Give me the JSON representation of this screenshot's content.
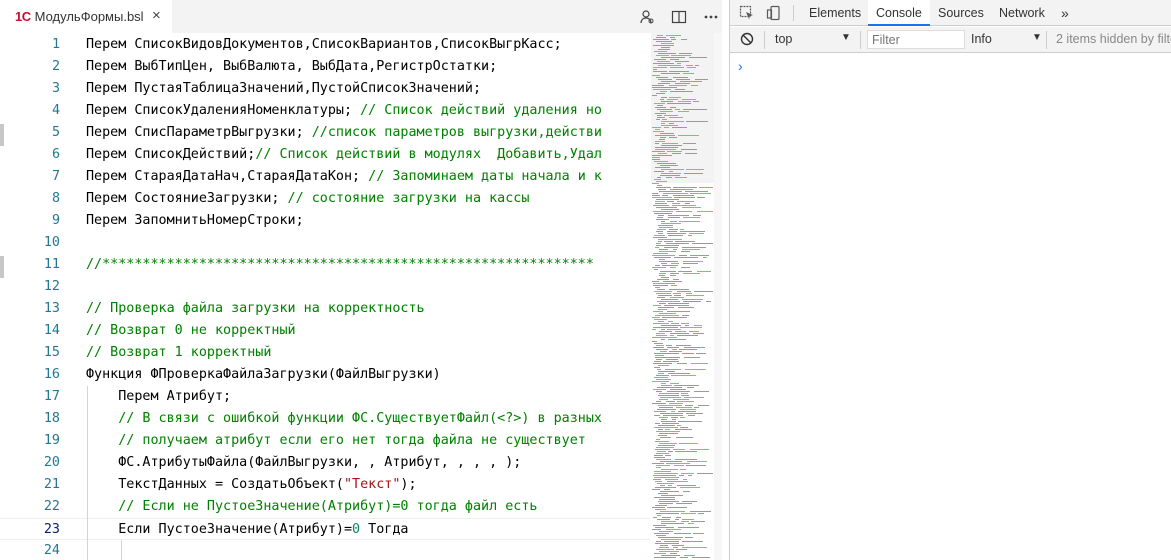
{
  "editor": {
    "tab": {
      "logo": "1С",
      "filename": "МодульФормы.bsl",
      "close": "×"
    },
    "toolbar_icons": [
      "person-search-icon",
      "split-editor-icon",
      "more-icon"
    ],
    "lines": [
      {
        "num": "1",
        "segments": [
          {
            "t": "Перем СписокВидовДокументов,СписокВариантов,СписокВыгрКасс;",
            "c": "k"
          }
        ]
      },
      {
        "num": "2",
        "segments": [
          {
            "t": "Перем ВыбТипЦен, ВыбВалюта, ВыбДата,РегистрОстатки;",
            "c": "k"
          }
        ]
      },
      {
        "num": "3",
        "segments": [
          {
            "t": "Перем ПустаяТаблицаЗначений,ПустойСписокЗначений;",
            "c": "k"
          }
        ]
      },
      {
        "num": "4",
        "segments": [
          {
            "t": "Перем СписокУдаленияНоменклатуры; ",
            "c": "k"
          },
          {
            "t": "// Список действий удаления но",
            "c": "c"
          }
        ]
      },
      {
        "num": "5",
        "segments": [
          {
            "t": "Перем СписПараметрВыгрузки; ",
            "c": "k"
          },
          {
            "t": "//список параметров выгрузки,действи",
            "c": "c"
          }
        ]
      },
      {
        "num": "6",
        "segments": [
          {
            "t": "Перем СписокДействий;",
            "c": "k"
          },
          {
            "t": "// Список действий в модулях  Добавить,Удал",
            "c": "c"
          }
        ]
      },
      {
        "num": "7",
        "segments": [
          {
            "t": "Перем СтараяДатаНач,СтараяДатаКон; ",
            "c": "k"
          },
          {
            "t": "// Запоминаем даты начала и к",
            "c": "c"
          }
        ]
      },
      {
        "num": "8",
        "segments": [
          {
            "t": "Перем СостояниеЗагрузки; ",
            "c": "k"
          },
          {
            "t": "// состояние загрузки на кассы",
            "c": "c"
          }
        ]
      },
      {
        "num": "9",
        "segments": [
          {
            "t": "Перем ЗапомнитьНомерСтроки;",
            "c": "k"
          }
        ]
      },
      {
        "num": "10",
        "segments": []
      },
      {
        "num": "11",
        "segments": [
          {
            "t": "//*************************************************************",
            "c": "c"
          }
        ]
      },
      {
        "num": "12",
        "segments": []
      },
      {
        "num": "13",
        "segments": [
          {
            "t": "// Проверка файла загрузки на корректность",
            "c": "c"
          }
        ]
      },
      {
        "num": "14",
        "segments": [
          {
            "t": "// Возврат 0 не корректный",
            "c": "c"
          }
        ]
      },
      {
        "num": "15",
        "segments": [
          {
            "t": "// Возврат 1 корректный",
            "c": "c"
          }
        ]
      },
      {
        "num": "16",
        "segments": [
          {
            "t": "Функция ФПроверкаФайлаЗагрузки(ФайлВыгрузки)",
            "c": "k"
          }
        ]
      },
      {
        "num": "17",
        "segments": [
          {
            "t": "    Перем Атрибут;",
            "c": "k"
          }
        ]
      },
      {
        "num": "18",
        "segments": [
          {
            "t": "    ",
            "c": "k"
          },
          {
            "t": "// В связи с ошибкой функции ФС.СуществуетФайл(<?>) в разных",
            "c": "c"
          }
        ]
      },
      {
        "num": "19",
        "segments": [
          {
            "t": "    ",
            "c": "k"
          },
          {
            "t": "// получаем атрибут если его нет тогда файла не существует",
            "c": "c"
          }
        ]
      },
      {
        "num": "20",
        "segments": [
          {
            "t": "    ФС.АтрибутыФайла(ФайлВыгрузки, , Атрибут, , , , );",
            "c": "k"
          }
        ]
      },
      {
        "num": "21",
        "segments": [
          {
            "t": "    ТекстДанных = СоздатьОбъект(",
            "c": "k"
          },
          {
            "t": "\"Текст\"",
            "c": "s"
          },
          {
            "t": ");",
            "c": "k"
          }
        ]
      },
      {
        "num": "22",
        "segments": [
          {
            "t": "    ",
            "c": "k"
          },
          {
            "t": "// Если не ПустоеЗначение(Атрибут)=0 тогда файл есть",
            "c": "c"
          }
        ]
      },
      {
        "num": "23",
        "segments": [
          {
            "t": "    Если ПустоеЗначение(Атрибут)=",
            "c": "k"
          },
          {
            "t": "0",
            "c": "n"
          },
          {
            "t": " Тогда",
            "c": "k"
          }
        ]
      },
      {
        "num": "24",
        "segments": []
      }
    ],
    "current_line": "23"
  },
  "devtools": {
    "tabs": [
      "Elements",
      "Console",
      "Sources",
      "Network"
    ],
    "active_tab": "Console",
    "more_tabs": "»",
    "toolbar": {
      "context": "top",
      "filter_placeholder": "Filter",
      "level": "Info",
      "hidden_info": "2 items hidden by filte"
    },
    "prompt": "›"
  }
}
